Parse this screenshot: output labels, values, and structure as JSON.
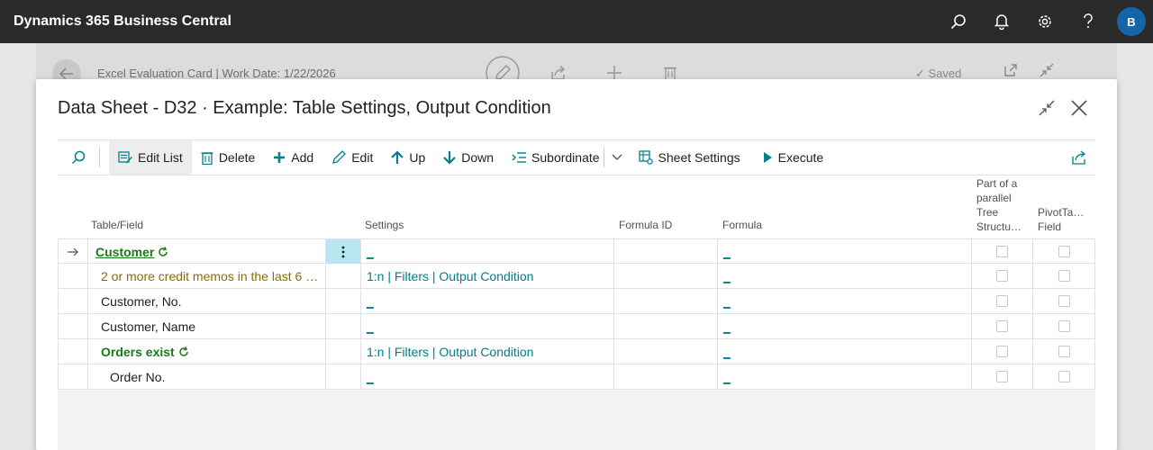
{
  "app": {
    "title": "Dynamics 365 Business Central",
    "avatar": "B"
  },
  "background_card": {
    "breadcrumb": "Excel Evaluation Card | Work Date: 1/22/2026",
    "saved": "Saved"
  },
  "dialog": {
    "title": "Data Sheet - D32 · Example: Table Settings, Output Condition"
  },
  "actions": {
    "edit_list": "Edit List",
    "delete": "Delete",
    "add": "Add",
    "edit": "Edit",
    "up": "Up",
    "down": "Down",
    "subordinate": "Subordinate",
    "sheet_settings": "Sheet Settings",
    "execute": "Execute"
  },
  "columns": {
    "table_field": "Table/Field",
    "settings": "Settings",
    "formula_id": "Formula ID",
    "formula": "Formula",
    "parallel_l1": "Part of a",
    "parallel_l2": "parallel",
    "parallel_l3": "Tree",
    "parallel_l4": "Structu…",
    "pivot_l1": "PivotTa…",
    "pivot_l2": "Field"
  },
  "rows": [
    {
      "field": "Customer",
      "settings": "_",
      "formula": "_"
    },
    {
      "field": "2 or more credit memos in the last 6 …",
      "settings": "1:n | Filters | Output Condition",
      "formula": "_"
    },
    {
      "field": "Customer, No.",
      "settings": "_",
      "formula": "_"
    },
    {
      "field": "Customer, Name",
      "settings": "_",
      "formula": "_"
    },
    {
      "field": "Orders exist",
      "settings": "1:n | Filters | Output Condition",
      "formula": "_"
    },
    {
      "field": "Order No.",
      "settings": "_",
      "formula": "_"
    }
  ],
  "colors": {
    "link": "#00808a",
    "green": "#1a7a1a",
    "olive": "#8a6d00",
    "appbar": "#2a2a2a",
    "avatar": "#1565a8"
  },
  "icons": [
    "search-icon",
    "bell-icon",
    "gear-icon",
    "help-icon",
    "back-arrow-icon",
    "pencil-icon",
    "share-icon",
    "plus-icon",
    "trash-icon",
    "collapse-icon",
    "close-icon",
    "refresh-icon",
    "more-vertical-icon",
    "row-arrow-icon"
  ]
}
